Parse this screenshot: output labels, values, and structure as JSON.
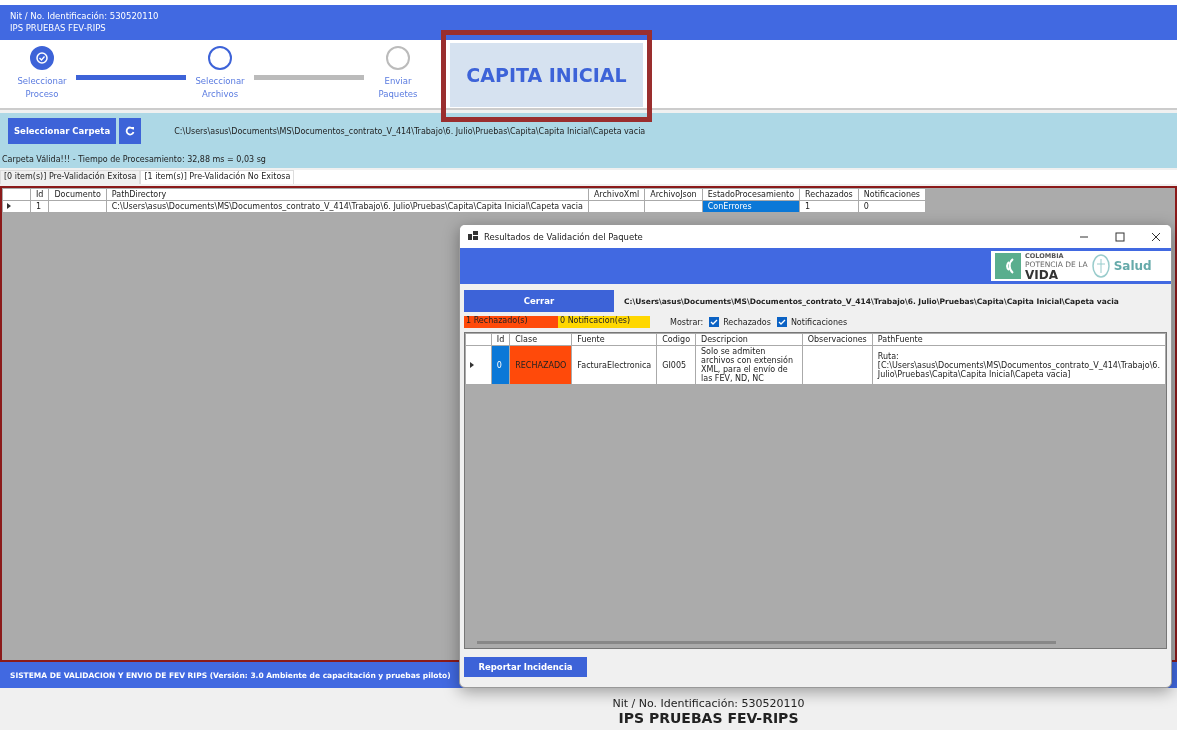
{
  "header": {
    "nit": "Nit / No. Identificación: 530520110",
    "name": "IPS PRUEBAS FEV-RIPS"
  },
  "stepper": {
    "steps": [
      {
        "kind": "done",
        "label": "Seleccionar Proceso"
      },
      {
        "kind": "current",
        "label": "Seleccionar Archivos"
      },
      {
        "kind": "pending",
        "label": "Enviar Paquetes"
      }
    ]
  },
  "process_label": "CAPITA INICIAL",
  "toolbar": {
    "select_button": "Seleccionar Carpeta",
    "path": "C:\\Users\\asus\\Documents\\MS\\Documentos_contrato_V_414\\Trabajo\\6. Julio\\Pruebas\\Capita\\Capita Inicial\\Capeta vacia"
  },
  "status_message": "Carpeta Válida!!! - Tiempo de Procesamiento: 32,88 ms = 0,03 sg",
  "tabs": [
    {
      "label": "[0 item(s)] Pre-Validación Exitosa",
      "selected": false
    },
    {
      "label": "[1 item(s)] Pre-Validación No Exitosa",
      "selected": true
    }
  ],
  "main_grid": {
    "columns": [
      "Id",
      "Documento",
      "PathDirectory",
      "ArchivoXml",
      "ArchivoJson",
      "EstadoProcesamiento",
      "Rechazados",
      "Notificaciones"
    ],
    "rows": [
      {
        "cells": [
          {
            "text": "1",
            "selected": false
          },
          {
            "selected": false
          },
          {
            "text": "C:\\Users\\asus\\Documents\\MS\\Documentos_contrato_V_414\\Trabajo\\6. Julio\\Pruebas\\Capita\\Capita Inicial\\Capeta vacia",
            "selected": false
          },
          {
            "selected": false
          },
          {
            "selected": false
          },
          {
            "text": "ConErrores",
            "selected": true
          },
          {
            "text": "1",
            "selected": false
          },
          {
            "text": "0",
            "selected": false
          }
        ]
      }
    ]
  },
  "footer": "SISTEMA DE VALIDACION Y ENVIO DE FEV RIPS  (Versión: 3.0 Ambiente de capacitación y pruebas piloto)",
  "bottom": {
    "nit": "Nit / No. Identificación: 530520110",
    "name": "IPS PRUEBAS FEV-RIPS"
  },
  "dialog": {
    "title": "Resultados de Validación del Paquete",
    "logo": {
      "line1": "COLOMBIA",
      "line2": "POTENCIA DE LA",
      "line3": "VIDA",
      "line4": "Salud"
    },
    "close_button": "Cerrar",
    "path": "C:\\Users\\asus\\Documents\\MS\\Documentos_contrato_V_414\\Trabajo\\6. Julio\\Pruebas\\Capita\\Capita Inicial\\Capeta vacia",
    "counts": [
      {
        "text": "1 Rechazado(s)",
        "color": "#ff4a0a"
      },
      {
        "text": "0 Notificacion(es)",
        "color": "#ffd700"
      }
    ],
    "show_label": "Mostrar:",
    "filters": [
      {
        "label": "Rechazados",
        "checked": true
      },
      {
        "label": "Notificaciones",
        "checked": true
      }
    ],
    "grid": {
      "columns": [
        "Id",
        "Clase",
        "Fuente",
        "Codigo",
        "Descripcion",
        "Observaciones",
        "PathFuente"
      ],
      "rows": [
        {
          "cells": [
            {
              "text": "0",
              "color": "#0b78d7"
            },
            {
              "text": "RECHAZADO",
              "color": "#ff4a0a"
            },
            {
              "text": "FacturaElectronica"
            },
            {
              "text": "GI005"
            },
            {
              "text": "Solo se admiten archivos con extensión XML, para el envío de las FEV, ND, NC"
            },
            {},
            {
              "text": "Ruta: [C:\\Users\\asus\\Documents\\MS\\Documentos_contrato_V_414\\Trabajo\\6. Julio\\Pruebas\\Capita\\Capita Inicial\\Capeta vacia]"
            }
          ]
        }
      ]
    },
    "report_button": "Reportar Incidencia"
  }
}
